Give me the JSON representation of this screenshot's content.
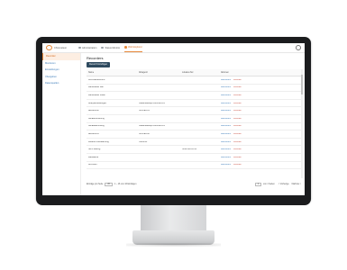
{
  "app": {
    "logo_text": "Chromeleon"
  },
  "topnav": [
    {
      "label": "Administration",
      "active": false
    },
    {
      "label": "Status Monitor",
      "active": false
    },
    {
      "label": "Web Explorer",
      "active": true
    }
  ],
  "sidebar": {
    "items": [
      {
        "label": "Recorder",
        "active": true
      },
      {
        "label": "Monitoren",
        "active": false
      },
      {
        "label": "Einstellungen",
        "active": false
      },
      {
        "label": "Übergeben",
        "active": false
      },
      {
        "label": "Datenquellen",
        "active": false
      }
    ]
  },
  "main": {
    "title": "Recorders",
    "create_label": "Record hinzufügen",
    "columns": [
      "Name",
      "Ablageort",
      "Lokales Ziel",
      "Aktionen"
    ],
    "rows": [
      {
        "name": "Kommandorecord",
        "dest": "",
        "loc": ""
      },
      {
        "name": "LabBrowser Lab",
        "dest": "",
        "loc": ""
      },
      {
        "name": "LabBrowser Lokal",
        "dest": "",
        "loc": ""
      },
      {
        "name": "Analysemessungen",
        "dest": "\\\\Datenbackup-Cohreckn-01",
        "loc": ""
      },
      {
        "name": "Bereichen2",
        "dest": "\\\\Fs-Lab-01",
        "loc": ""
      },
      {
        "name": "Gerätemonitoring",
        "dest": "",
        "loc": ""
      },
      {
        "name": "Gerätesammlung",
        "dest": "\\\\Datenbackup-Cohreckn-01",
        "loc": ""
      },
      {
        "name": "Bereichen1",
        "dest": "\\\\Fs-Lab-02",
        "loc": ""
      },
      {
        "name": "Weitere Überwachung",
        "dest": "\\\\NAS-01",
        "loc": ""
      },
      {
        "name": "NAS Sharing",
        "dest": "",
        "loc": "\\\\192.168.10.34"
      },
      {
        "name": "Messwerte",
        "dest": "",
        "loc": ""
      },
      {
        "name": "Archiviert",
        "dest": "",
        "loc": ""
      }
    ],
    "edit_label": "Bearbeiten",
    "delete_label": "Löschen"
  },
  "footer": {
    "per_page_label": "Einträge pro Seite",
    "per_page_value": "20",
    "range_text": "1 – 16 von 16 Einträgen",
    "page_number": "1",
    "page_info": "von 1 Seiten",
    "prev_label": "< Vorherige",
    "next_label": "Nächste >"
  }
}
